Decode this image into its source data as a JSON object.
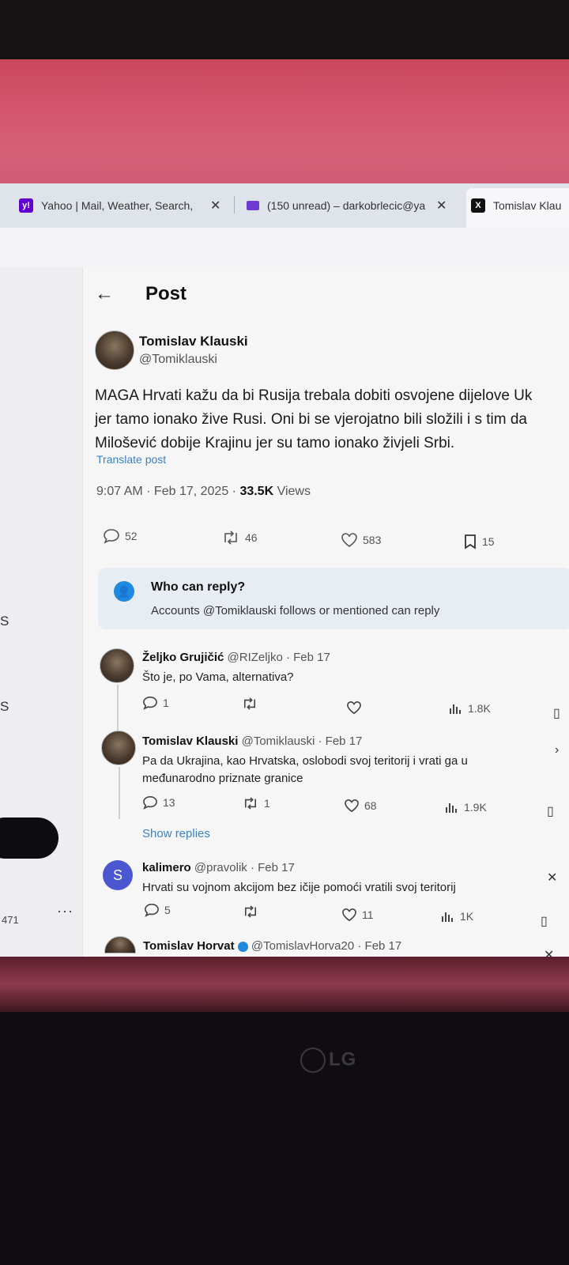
{
  "browser": {
    "tabs": [
      {
        "label": "Yahoo | Mail, Weather, Search, P",
        "icon": "yahoo-icon"
      },
      {
        "label": "(150 unread) – darkobrlecic@ya",
        "icon": "mail-icon"
      },
      {
        "label": "Tomislav Klau",
        "icon": "x-logo-icon"
      }
    ],
    "close_glyph": "✕"
  },
  "post": {
    "back_glyph": "←",
    "header_title": "Post",
    "author_name": "Tomislav Klauski",
    "author_handle": "@Tomiklauski",
    "body_lines": [
      "MAGA Hrvati kažu da bi Rusija trebala dobiti osvojene dijelove Uk",
      "jer tamo ionako žive Rusi. Oni bi se vjerojatno bili složili i s tim da",
      "Milošević dobije Krajinu jer su tamo ionako živjeli Srbi."
    ],
    "translate": "Translate post",
    "time": "9:07 AM · Feb 17, 2025 · ",
    "views_count": "33.5K",
    "views_label": " Views",
    "stats": {
      "replies": "52",
      "reposts": "46",
      "likes": "583",
      "bookmarks": "15"
    }
  },
  "who_can_reply": {
    "title": "Who can reply?",
    "subtitle": "Accounts @Tomiklauski follows or mentioned can reply"
  },
  "replies": [
    {
      "name": "Željko Grujičić",
      "meta": " @RIZeljko · Feb 17",
      "text_lines": [
        "Što je, po Vama, alternativa?"
      ],
      "stats": {
        "replies": "1",
        "reposts": "",
        "likes": "",
        "views": "1.8K"
      }
    },
    {
      "name": "Tomislav Klauski",
      "meta": " @Tomiklauski · Feb 17",
      "text_lines": [
        "Pa da Ukrajina, kao Hrvatska, oslobodi svoj teritorij i vrati ga u",
        "međunarodno priznate granice"
      ],
      "stats": {
        "replies": "13",
        "reposts": "1",
        "likes": "68",
        "views": "1.9K"
      }
    },
    {
      "name": "kalimero",
      "meta": " @pravolik · Feb 17",
      "avatar_letter": "S",
      "text_lines": [
        "Hrvati su vojnom akcijom bez ičije pomoći vratili svoj teritorij"
      ],
      "stats": {
        "replies": "5",
        "reposts": "",
        "likes": "11",
        "views": "1K"
      }
    },
    {
      "name": "Tomislav Horvat",
      "meta": " @TomislavHorva20 · Feb 17"
    }
  ],
  "show_replies": "Show replies",
  "left_rail": {
    "s1": "S",
    "s2": "S",
    "count": "471",
    "dots": "···"
  },
  "monitor_brand": "LG",
  "colors": {
    "accent": "#1d8ae0",
    "link": "#3b82c4",
    "wall": "#d4566c"
  }
}
